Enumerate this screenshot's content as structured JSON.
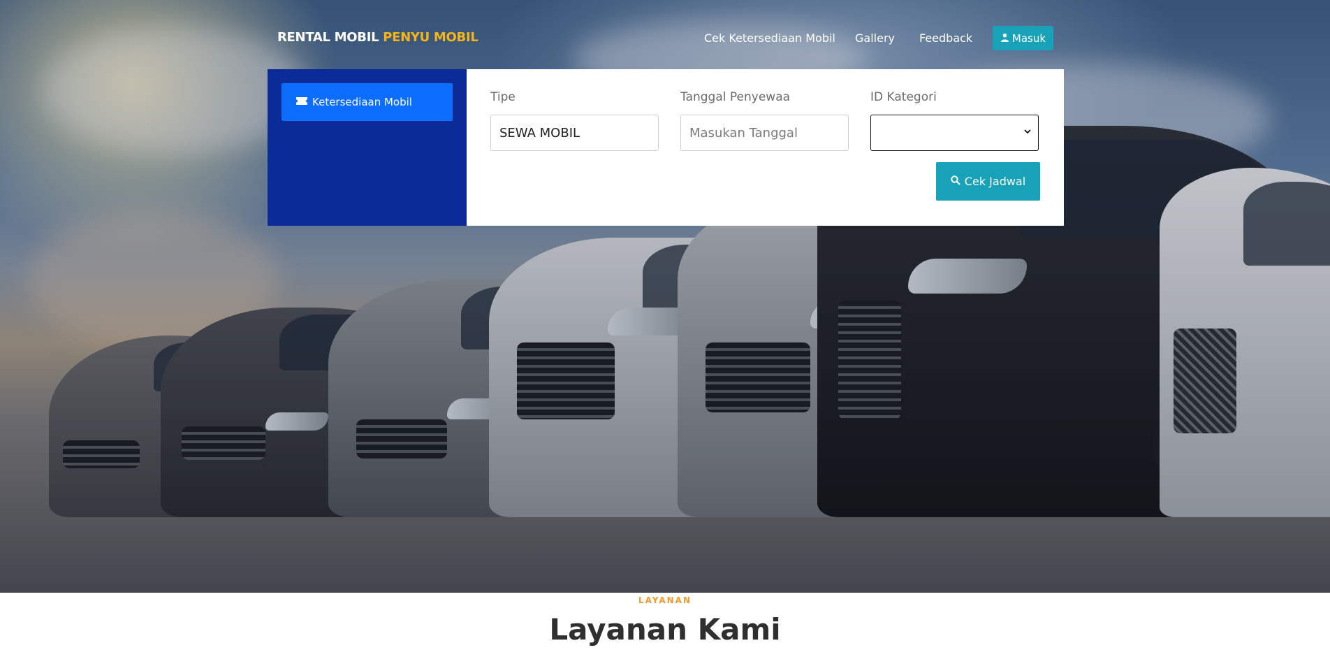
{
  "brand": {
    "primary": "RENTAL MOBIL ",
    "accent": "PENYU MOBIL",
    "accent_color": "#f4b41a"
  },
  "nav": {
    "links": [
      "Cek Ketersediaan Mobil",
      "Gallery",
      "Feedback"
    ],
    "login_label": "Masuk",
    "login_icon": "user-icon",
    "button_color": "#17a2b8"
  },
  "booking": {
    "tab_label": "Ketersediaan Mobil",
    "tab_icon": "ticket-icon",
    "panel_color": "#0b2b99",
    "tab_color": "#0d6efd",
    "fields": {
      "tipe": {
        "label": "Tipe",
        "value": "SEWA MOBIL"
      },
      "tanggal": {
        "label": "Tanggal Penyewaa",
        "placeholder": "Masukan Tanggal"
      },
      "kategori": {
        "label": "ID Kategori",
        "value": ""
      }
    },
    "submit_label": "Cek Jadwal",
    "submit_icon": "search-icon"
  },
  "services": {
    "kicker": "LAYANAN",
    "title": "Layanan Kami",
    "kicker_color": "#f29a2e"
  }
}
